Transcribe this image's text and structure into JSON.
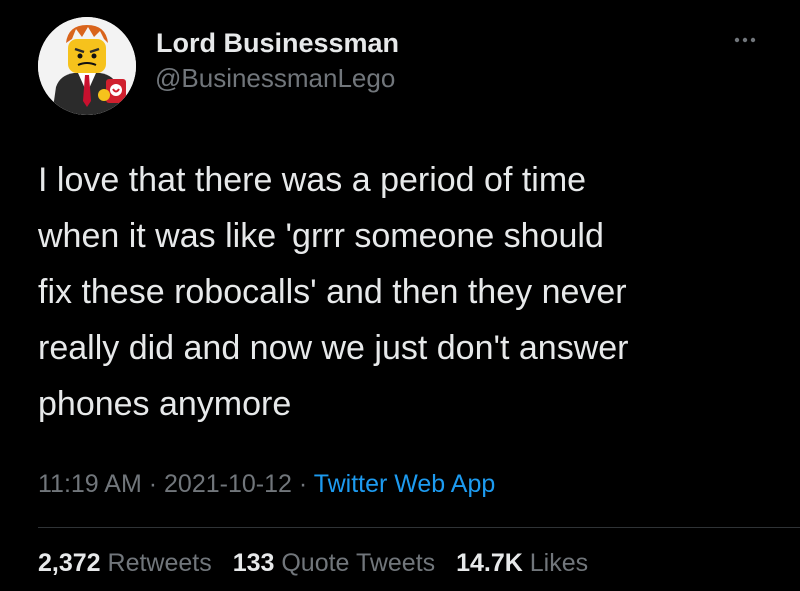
{
  "author": {
    "display_name": "Lord Businessman",
    "handle": "@BusinessmanLego",
    "avatar_icon": "lego-businessman-avatar"
  },
  "more_icon": "more-horizontal-icon",
  "tweet": {
    "text_lines": [
      "I love that there was a period of time",
      "when it was like 'grrr someone should",
      "fix these robocalls' and then they never",
      "really did and now we just don't answer",
      "phones anymore"
    ],
    "time": "11:19 AM",
    "separator": "·",
    "date": "2021-10-12",
    "source": "Twitter Web App"
  },
  "stats": {
    "retweets_count": "2,372",
    "retweets_label": "Retweets",
    "quotes_count": "133",
    "quotes_label": "Quote Tweets",
    "likes_count": "14.7K",
    "likes_label": "Likes"
  },
  "colors": {
    "background": "#000000",
    "text": "#e7e9ea",
    "secondary": "#71767b",
    "link": "#1d9bf0",
    "divider": "#2f3336"
  }
}
